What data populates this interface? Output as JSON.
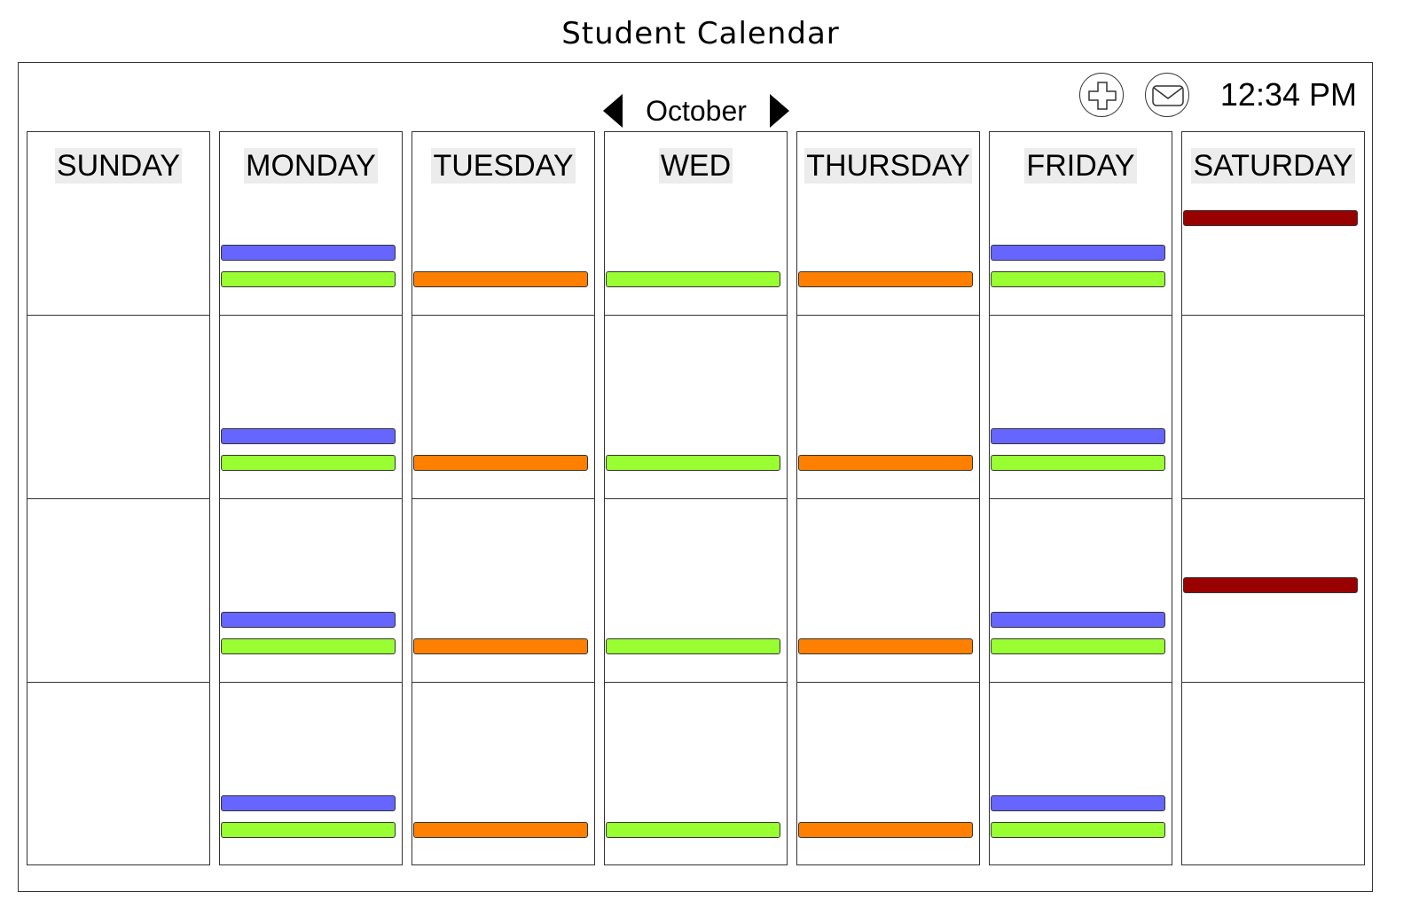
{
  "app_title": "Student Calendar",
  "month": "October",
  "clock": "12:34 PM",
  "toolbar": {
    "add_icon": "plus-icon",
    "mail_icon": "envelope-icon"
  },
  "colors": {
    "blue": "#6666ff",
    "green": "#99ff33",
    "orange": "#ff8000",
    "red": "#990000"
  },
  "days": [
    {
      "label": "SUNDAY",
      "weeks": [
        [],
        [],
        [],
        []
      ]
    },
    {
      "label": "MONDAY",
      "weeks": [
        [
          "blue",
          "green"
        ],
        [
          "blue",
          "green"
        ],
        [
          "blue",
          "green"
        ],
        [
          "blue",
          "green"
        ]
      ]
    },
    {
      "label": "TUESDAY",
      "weeks": [
        [
          "orange"
        ],
        [
          "orange"
        ],
        [
          "orange"
        ],
        [
          "orange"
        ]
      ]
    },
    {
      "label": "WED",
      "weeks": [
        [
          "green"
        ],
        [
          "green"
        ],
        [
          "green"
        ],
        [
          "green"
        ]
      ]
    },
    {
      "label": "THURSDAY",
      "weeks": [
        [
          "orange"
        ],
        [
          "orange"
        ],
        [
          "orange"
        ],
        [
          "orange"
        ]
      ]
    },
    {
      "label": "FRIDAY",
      "weeks": [
        [
          "blue",
          "green"
        ],
        [
          "blue",
          "green"
        ],
        [
          "blue",
          "green"
        ],
        [
          "blue",
          "green"
        ]
      ]
    },
    {
      "label": "SATURDAY",
      "weeks": [
        [
          "red"
        ],
        [],
        [
          "red"
        ],
        []
      ]
    }
  ]
}
